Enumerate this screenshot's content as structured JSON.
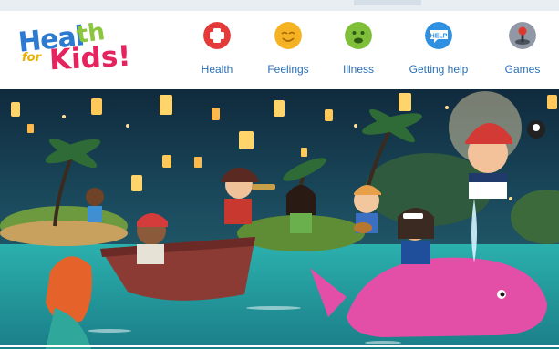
{
  "logo": {
    "line1": "Heal",
    "line1b": "th",
    "small": "for",
    "line2": "Kids!"
  },
  "nav": {
    "items": [
      {
        "label": "Health",
        "icon": "plus-icon",
        "color": "#e53a3a"
      },
      {
        "label": "Feelings",
        "icon": "smiley-face-icon",
        "color": "#f5b324"
      },
      {
        "label": "Illness",
        "icon": "sick-face-icon",
        "color": "#7fbf3a"
      },
      {
        "label": "Getting help",
        "icon": "help-speech-bubble-icon",
        "color": "#2f8fe0"
      },
      {
        "label": "Games",
        "icon": "joystick-icon",
        "color": "#8f98a4"
      }
    ]
  },
  "hero": {
    "image": "pirate-kids-island-lantern-scene",
    "colors": {
      "sky": "#15384f",
      "sea": "#2aa6a8",
      "boat": "#8b3b34",
      "whale": "#e34ea7"
    }
  }
}
